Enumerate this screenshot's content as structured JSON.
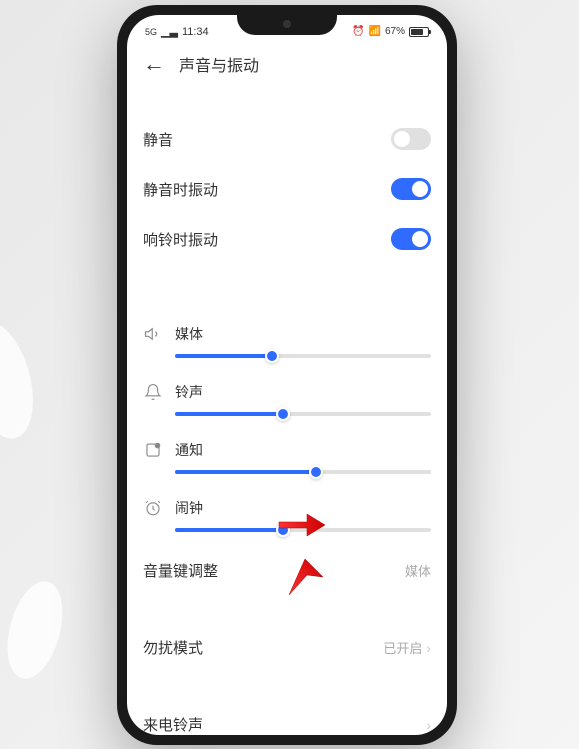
{
  "status": {
    "network": "5G",
    "time": "11:34",
    "battery": "67%"
  },
  "header": {
    "title": "声音与振动"
  },
  "toggles": {
    "mute": {
      "label": "静音",
      "on": false
    },
    "vibrate_mute": {
      "label": "静音时振动",
      "on": true
    },
    "vibrate_ring": {
      "label": "响铃时振动",
      "on": true
    }
  },
  "sliders": {
    "media": {
      "label": "媒体",
      "value": 38
    },
    "ringtone": {
      "label": "铃声",
      "value": 42
    },
    "notification": {
      "label": "通知",
      "value": 55
    },
    "alarm": {
      "label": "闹钟",
      "value": 42
    }
  },
  "links": {
    "volume_key": {
      "label": "音量键调整",
      "value": "媒体"
    },
    "dnd": {
      "label": "勿扰模式",
      "value": "已开启"
    },
    "incoming": {
      "label": "来电铃声",
      "value": ""
    }
  }
}
